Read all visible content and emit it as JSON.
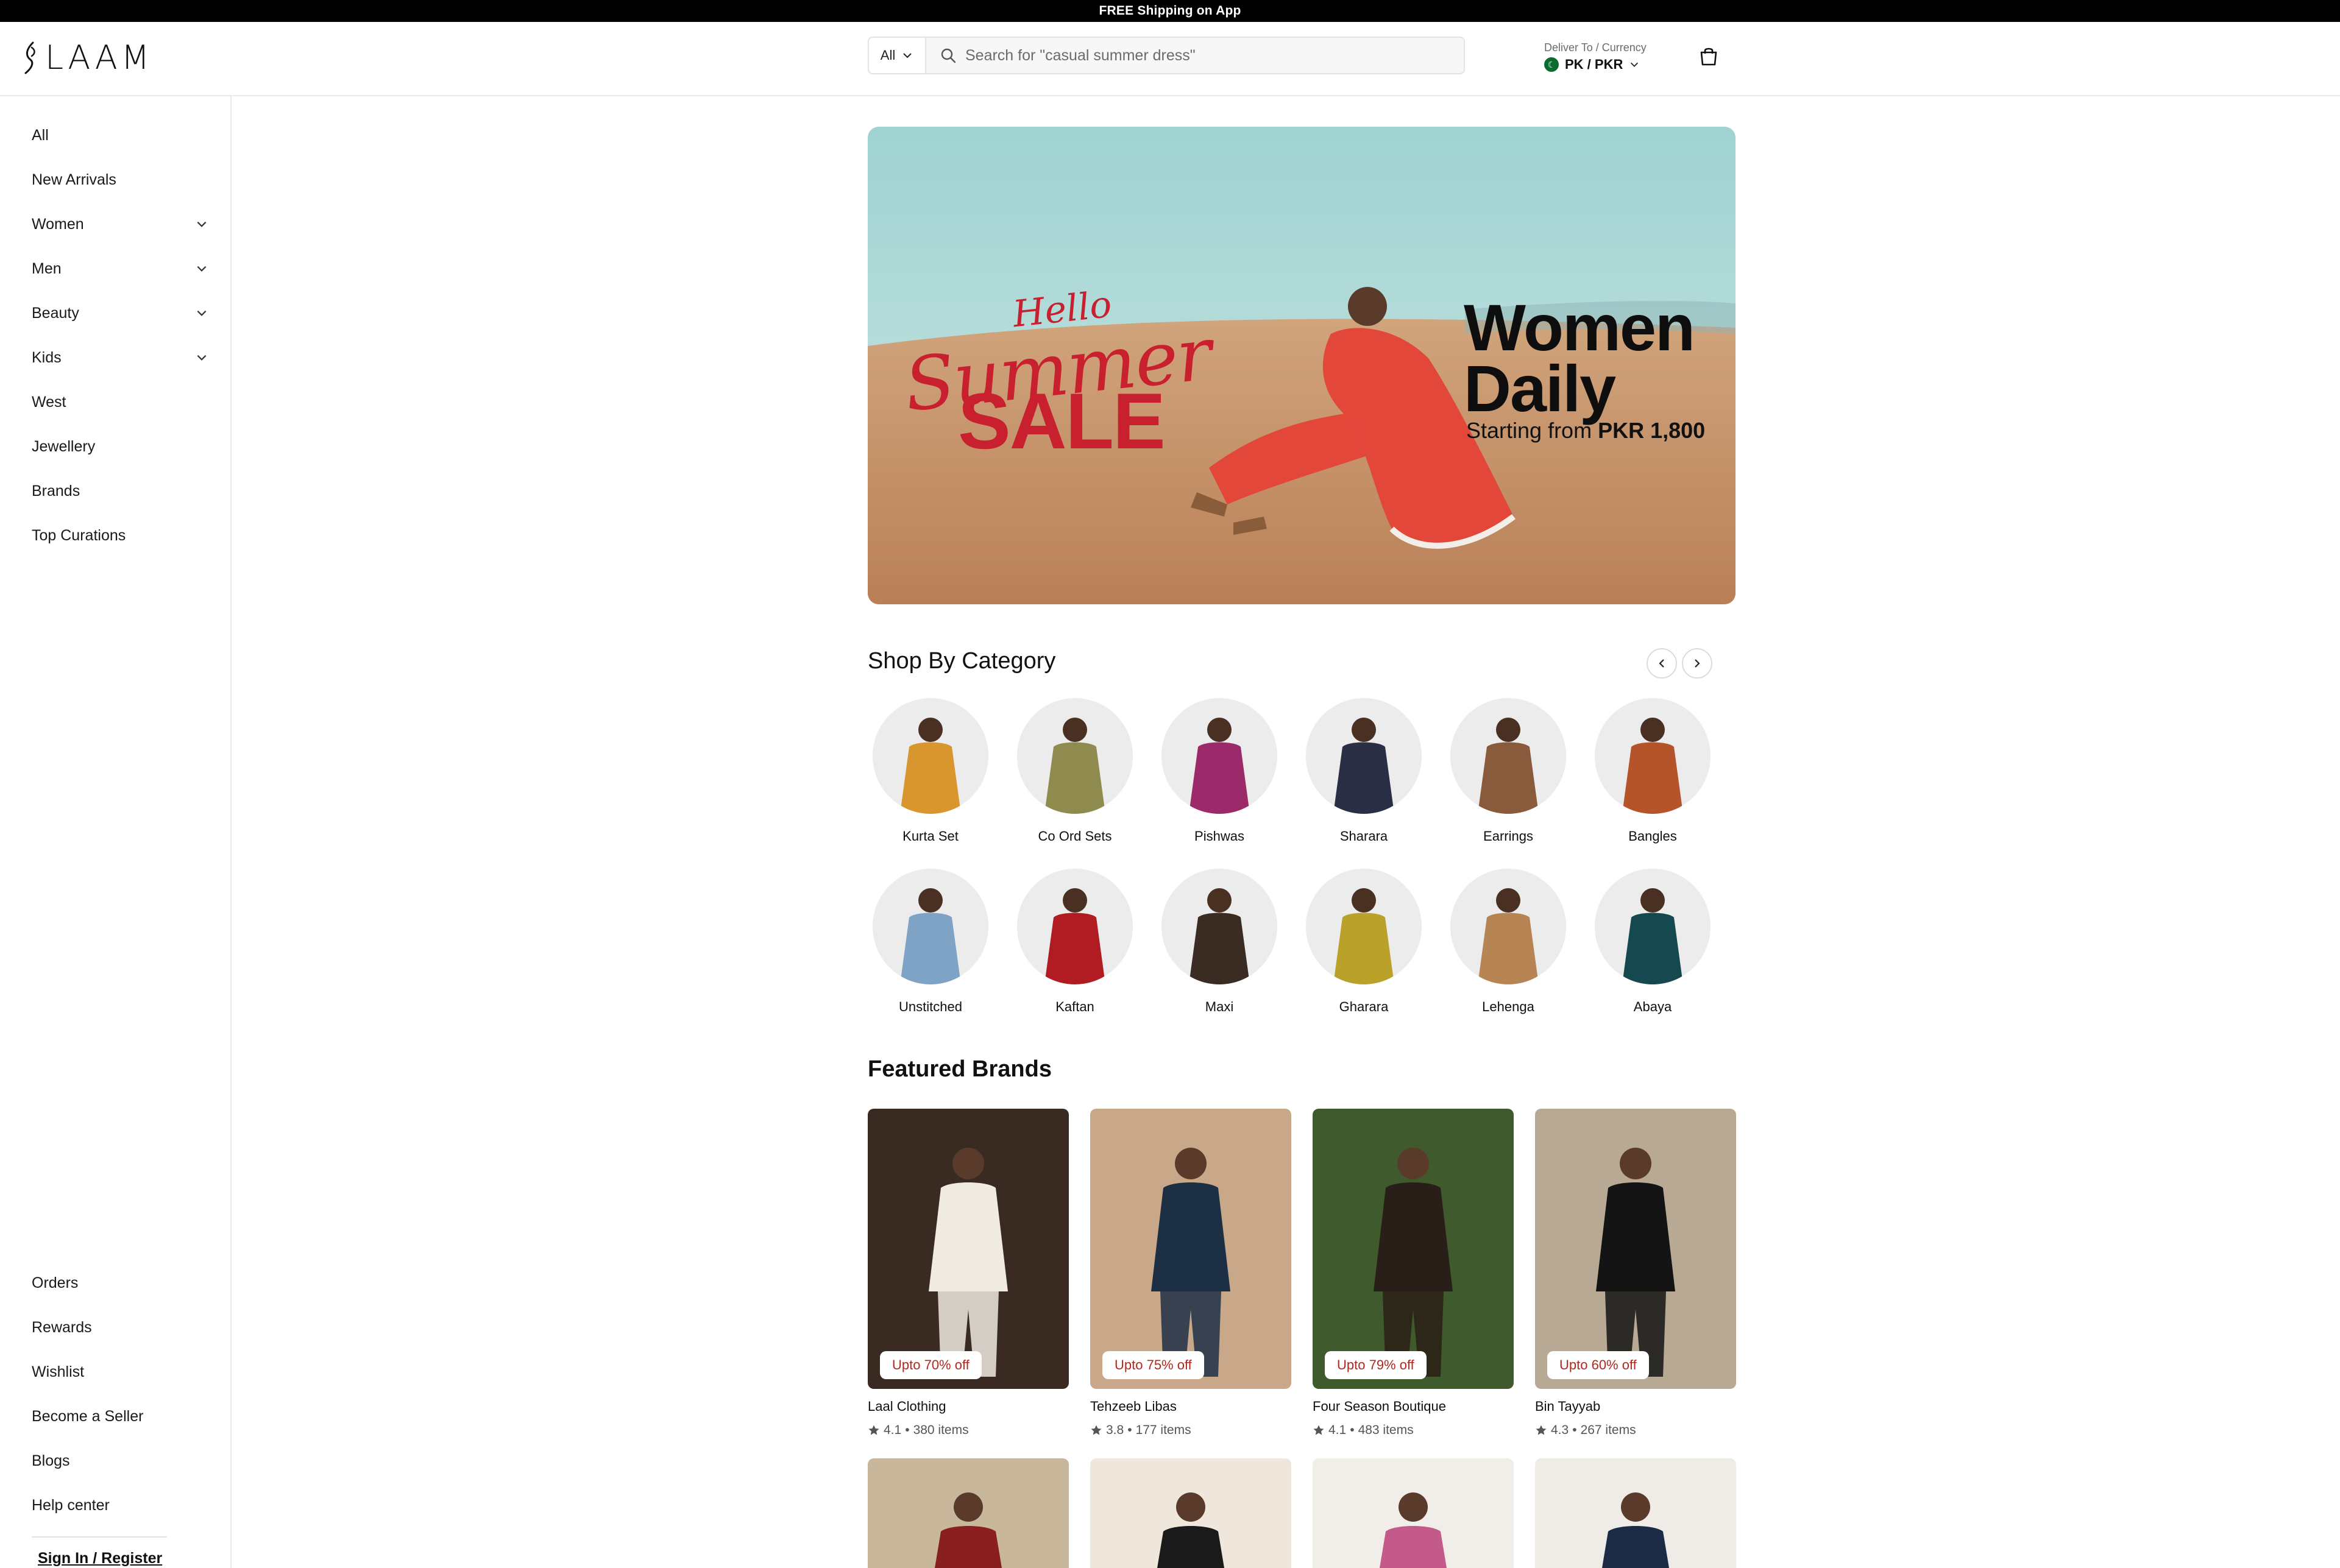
{
  "announcement": "FREE Shipping on App",
  "brand": {
    "name": "LAAM"
  },
  "search": {
    "category": "All",
    "placeholder": "Search for \"casual summer dress\""
  },
  "deliver": {
    "label": "Deliver To / Currency",
    "value": "PK / PKR"
  },
  "sidebar": {
    "items": [
      {
        "label": "All",
        "expandable": false
      },
      {
        "label": "New Arrivals",
        "expandable": false
      },
      {
        "label": "Women",
        "expandable": true
      },
      {
        "label": "Men",
        "expandable": true
      },
      {
        "label": "Beauty",
        "expandable": true
      },
      {
        "label": "Kids",
        "expandable": true
      },
      {
        "label": "West",
        "expandable": false
      },
      {
        "label": "Jewellery",
        "expandable": false
      },
      {
        "label": "Brands",
        "expandable": false
      },
      {
        "label": "Top Curations",
        "expandable": false
      }
    ],
    "bottom_items": [
      "Orders",
      "Rewards",
      "Wishlist",
      "Become a Seller",
      "Blogs",
      "Help center"
    ],
    "signin": "Sign In / Register"
  },
  "hero": {
    "hello": "Hello",
    "summer": "Summer",
    "sale": "SALE",
    "women": "Women",
    "daily": "Daily",
    "starting": "Starting from",
    "price": "PKR 1,800"
  },
  "sections": {
    "shop_by_category": "Shop By Category",
    "featured_brands": "Featured Brands"
  },
  "categories": [
    {
      "label": "Kurta Set",
      "color": "#d9962e"
    },
    {
      "label": "Co Ord Sets",
      "color": "#8f8a4e"
    },
    {
      "label": "Pishwas",
      "color": "#9c2a6a"
    },
    {
      "label": "Sharara",
      "color": "#2a2f45"
    },
    {
      "label": "Earrings",
      "color": "#8a5a3c"
    },
    {
      "label": "Bangles",
      "color": "#b5542a"
    },
    {
      "label": "Unstitched",
      "color": "#7fa3c4"
    },
    {
      "label": "Kaftan",
      "color": "#b01c22"
    },
    {
      "label": "Maxi",
      "color": "#3a2c22"
    },
    {
      "label": "Gharara",
      "color": "#b9a12a"
    },
    {
      "label": "Lehenga",
      "color": "#b78554"
    },
    {
      "label": "Abaya",
      "color": "#16494f"
    }
  ],
  "brands": [
    {
      "name": "Laal Clothing",
      "discount": "Upto 70% off",
      "rating": "4.1",
      "items": "380 items",
      "bg": "#3a2b22",
      "dress": "#efeae2"
    },
    {
      "name": "Tehzeeb Libas",
      "discount": "Upto 75% off",
      "rating": "3.8",
      "items": "177 items",
      "bg": "#c9a88a",
      "dress": "#1d2f45"
    },
    {
      "name": "Four Season Boutique",
      "discount": "Upto 79% off",
      "rating": "4.1",
      "items": "483 items",
      "bg": "#3f5a2d",
      "dress": "#2a1f18"
    },
    {
      "name": "Bin Tayyab",
      "discount": "Upto 60% off",
      "rating": "4.3",
      "items": "267 items",
      "bg": "#b7a994",
      "dress": "#141414"
    }
  ],
  "brands_row2": [
    {
      "bg": "#c8b79a",
      "dress": "#8a1f1f"
    },
    {
      "bg": "#efe7dc",
      "dress": "#1a1a1a"
    },
    {
      "bg": "#f1ede8",
      "dress": "#c45a8a"
    },
    {
      "bg": "#efece7",
      "dress": "#1b2a45"
    }
  ],
  "colors": {
    "sale_red": "#c8202e",
    "badge_red": "#b3261e"
  }
}
